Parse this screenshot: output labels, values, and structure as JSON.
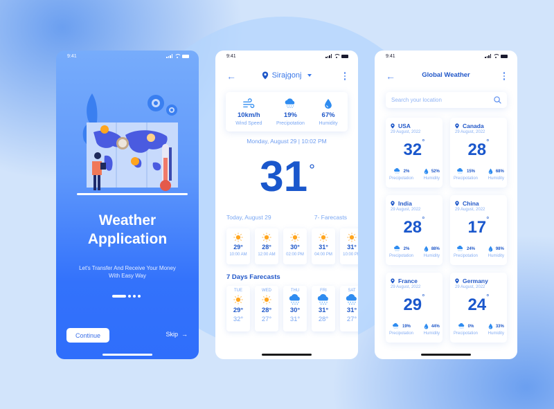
{
  "colors": {
    "primary": "#1a57cc",
    "accent": "#3a78e8",
    "light_text": "#7aa7f3",
    "sun": "#ffa51f",
    "onboarding_bg": "#3372fb"
  },
  "status_bar": {
    "time": "9:41"
  },
  "onboarding": {
    "title_line1": "Weather",
    "title_line2": "Application",
    "subtitle_line1": "Let's Transfer And Receive Your Money",
    "subtitle_line2": "With Easy Way",
    "page_indicator": {
      "total": 4,
      "active": 1
    },
    "continue_label": "Continue",
    "skip_label": "Skip",
    "skip_icon": "arrow-right-icon"
  },
  "detail": {
    "location": "Sirajgonj",
    "stats": [
      {
        "icon": "wind-icon",
        "value": "10km/h",
        "label": "Wind Speed"
      },
      {
        "icon": "snow-cloud-icon",
        "value": "19%",
        "label": "Precipotation"
      },
      {
        "icon": "droplet-icon",
        "value": "67%",
        "label": "Humidity"
      }
    ],
    "datetime": "Monday, August 29 | 10:02 PM",
    "current_temp": "31",
    "degree": "°",
    "today_label": "Today, August 29",
    "forecast_link": "7- Farecasts",
    "hourly": [
      {
        "icon": "sun-icon",
        "temp": "29°",
        "time": "10:00 AM"
      },
      {
        "icon": "sun-icon",
        "temp": "28°",
        "time": "12:00 AM"
      },
      {
        "icon": "sun-icon",
        "temp": "30°",
        "time": "02:00 PM"
      },
      {
        "icon": "sun-icon",
        "temp": "31°",
        "time": "04:00 PM"
      },
      {
        "icon": "sun-icon",
        "temp": "31°",
        "time": "10:00 PM"
      }
    ],
    "days_title": "7 Days Farecasts",
    "daily": [
      {
        "day": "TUE",
        "icon": "sun-icon",
        "high": "29°",
        "low": "32°"
      },
      {
        "day": "WED",
        "icon": "sun-icon",
        "high": "28°",
        "low": "27°"
      },
      {
        "day": "THU",
        "icon": "snow-cloud-icon",
        "high": "30°",
        "low": "31°"
      },
      {
        "day": "FRI",
        "icon": "snow-cloud-icon",
        "high": "31°",
        "low": "28°"
      },
      {
        "day": "SAT",
        "icon": "snow-cloud-icon",
        "high": "31°",
        "low": "27°"
      }
    ]
  },
  "global": {
    "title": "Global Weather",
    "search_placeholder": "Search your location",
    "precip_label": "Precipotation",
    "humidity_label": "Humidity",
    "cities": [
      {
        "name": "USA",
        "date": "29 August, 2022",
        "temp": "32",
        "precip": "2%",
        "humidity": "52%"
      },
      {
        "name": "Canada",
        "date": "29 August, 2022",
        "temp": "28",
        "precip": "15%",
        "humidity": "68%"
      },
      {
        "name": "India",
        "date": "29 August, 2022",
        "temp": "28",
        "precip": "2%",
        "humidity": "88%"
      },
      {
        "name": "China",
        "date": "29 August, 2022",
        "temp": "17",
        "precip": "24%",
        "humidity": "98%"
      },
      {
        "name": "France",
        "date": "29 August, 2022",
        "temp": "29",
        "precip": "19%",
        "humidity": "44%"
      },
      {
        "name": "Germany",
        "date": "29 August, 2022",
        "temp": "24",
        "precip": "0%",
        "humidity": "33%"
      }
    ]
  }
}
